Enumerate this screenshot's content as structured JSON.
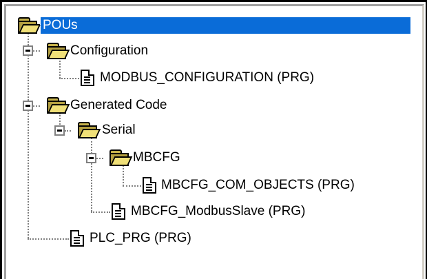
{
  "tree": {
    "root": {
      "label": "POUs",
      "selected": true
    },
    "configuration": {
      "label": "Configuration"
    },
    "modbus_configuration": {
      "label": "MODBUS_CONFIGURATION (PRG)"
    },
    "generated_code": {
      "label": "Generated Code"
    },
    "serial": {
      "label": "Serial"
    },
    "mbcfg": {
      "label": "MBCFG"
    },
    "mbcfg_com_objects": {
      "label": "MBCFG_COM_OBJECTS (PRG)"
    },
    "mbcfg_modbus_slave": {
      "label": "MBCFG_ModbusSlave (PRG)"
    },
    "plc_prg": {
      "label": "PLC_PRG (PRG)"
    }
  },
  "colors": {
    "selection": "#0a6cd8",
    "folder": "#f0e078",
    "tree_lines": "#808080"
  },
  "icons": {
    "folder": "folder-open-icon",
    "pou": "document-icon",
    "collapse": "collapse-toggle-icon"
  }
}
